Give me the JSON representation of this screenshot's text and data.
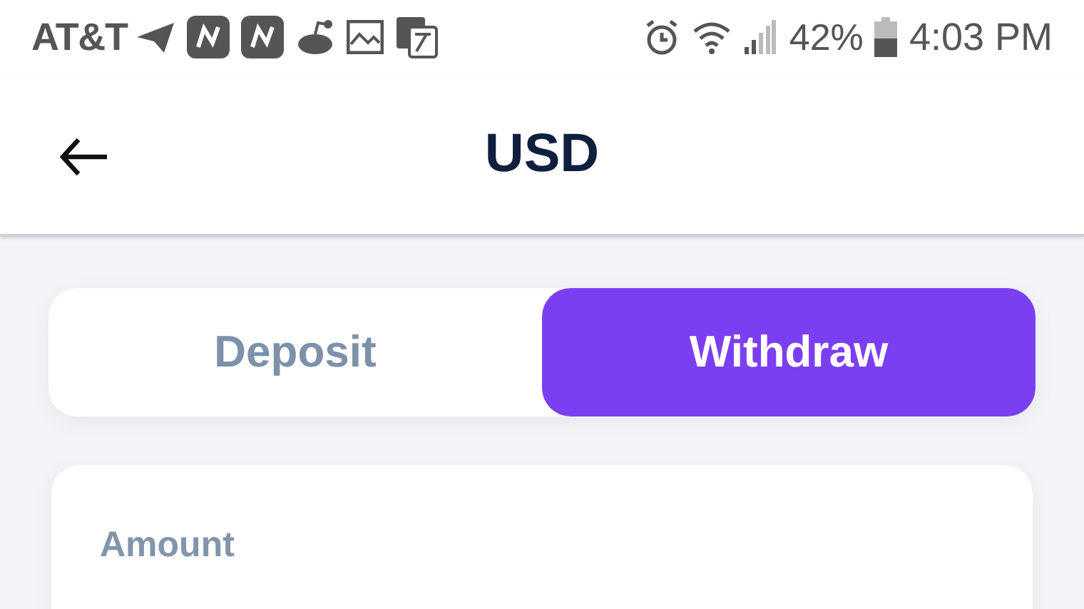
{
  "status_bar": {
    "carrier": "AT&T",
    "battery_percent": "42%",
    "time": "4:03 PM"
  },
  "header": {
    "title": "USD"
  },
  "tabs": [
    {
      "label": "Deposit",
      "selected": false
    },
    {
      "label": "Withdraw",
      "selected": true
    }
  ],
  "form": {
    "amount_label": "Amount"
  }
}
